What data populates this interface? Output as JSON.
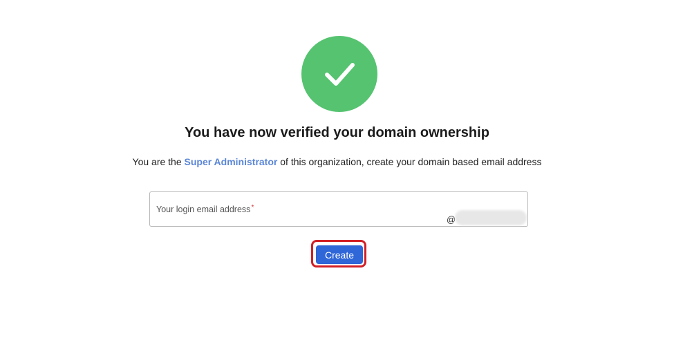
{
  "status": {
    "icon": "checkmark-icon",
    "color": "#55c370"
  },
  "heading": {
    "title": "You have now verified your domain ownership",
    "subtitle_prefix": "You are the",
    "subtitle_role": "Super Administrator",
    "subtitle_suffix": "of this organization, create your domain based email address",
    "role_color": "#5b86d6"
  },
  "email_field": {
    "label": "Your login email address",
    "required_marker": "*",
    "value": "",
    "at_sign": "@"
  },
  "actions": {
    "create_label": "Create",
    "button_color": "#2f66d8",
    "highlight_color": "#d21f26"
  }
}
